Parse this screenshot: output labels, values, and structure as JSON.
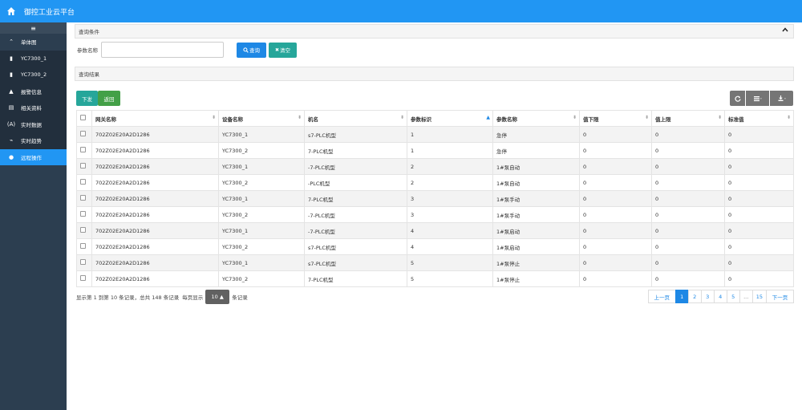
{
  "app": {
    "title": "御控工业云平台"
  },
  "sidebar": {
    "toggle": "≡",
    "items": [
      {
        "label": "单体图",
        "icon": "chevron-up-icon",
        "glyph": "⌃"
      },
      {
        "label": "YC7300_1",
        "icon": "device-icon",
        "glyph": "▮"
      },
      {
        "label": "YC7300_2",
        "icon": "device-icon",
        "glyph": "▮"
      },
      {
        "label": "报警信息",
        "icon": "warning-icon",
        "glyph": "▲"
      },
      {
        "label": "相关资料",
        "icon": "document-icon",
        "glyph": "▤"
      },
      {
        "label": "实时数据",
        "icon": "data-icon",
        "glyph": "(A)"
      },
      {
        "label": "实时趋势",
        "icon": "trend-icon",
        "glyph": "⌁"
      },
      {
        "label": "远程操作",
        "icon": "location-icon",
        "glyph": "●"
      }
    ]
  },
  "query": {
    "header": "查询条件",
    "param_label": "参数名称",
    "param_value": "",
    "search_label": "查询",
    "clear_label": "清空"
  },
  "results": {
    "header": "查询结果",
    "issue_label": "下发",
    "back_label": "返回"
  },
  "table": {
    "columns": [
      "网关名称",
      "设备名称",
      "机名",
      "参数标识",
      "参数名称",
      "值下限",
      "值上限",
      "标准值"
    ],
    "rows": [
      [
        "702Z02E20A2D1286",
        "YC7300_1",
        "s7-PLC机型",
        "1",
        "急停",
        "0",
        "0",
        "0"
      ],
      [
        "702Z02E20A2D1286",
        "YC7300_2",
        "7-PLC机型",
        "1",
        "急停",
        "0",
        "0",
        "0"
      ],
      [
        "702Z02E20A2D1286",
        "YC7300_1",
        "-7-PLC机型",
        "2",
        "1#泵自动",
        "0",
        "0",
        "0"
      ],
      [
        "702Z02E20A2D1286",
        "YC7300_2",
        "-PLC机型",
        "2",
        "1#泵自动",
        "0",
        "0",
        "0"
      ],
      [
        "702Z02E20A2D1286",
        "YC7300_1",
        "7-PLC机型",
        "3",
        "1#泵手动",
        "0",
        "0",
        "0"
      ],
      [
        "702Z02E20A2D1286",
        "YC7300_2",
        "-7-PLC机型",
        "3",
        "1#泵手动",
        "0",
        "0",
        "0"
      ],
      [
        "702Z02E20A2D1286",
        "YC7300_1",
        "-7-PLC机型",
        "4",
        "1#泵启动",
        "0",
        "0",
        "0"
      ],
      [
        "702Z02E20A2D1286",
        "YC7300_2",
        "s7-PLC机型",
        "4",
        "1#泵启动",
        "0",
        "0",
        "0"
      ],
      [
        "702Z02E20A2D1286",
        "YC7300_1",
        "s7-PLC机型",
        "5",
        "1#泵停止",
        "0",
        "0",
        "0"
      ],
      [
        "702Z02E20A2D1286",
        "YC7300_2",
        "7-PLC机型",
        "5",
        "1#泵停止",
        "0",
        "0",
        "0"
      ]
    ]
  },
  "pagination": {
    "summary": "显示第 1 到第 10 条记录，总共 148 条记录",
    "per_page_prefix": "每页显示",
    "per_page": "10 ▲",
    "per_page_suffix": "条记录",
    "prev": "上一页",
    "pages": [
      "1",
      "2",
      "3",
      "4",
      "5",
      "...",
      "15"
    ],
    "next": "下一页",
    "current": "1"
  }
}
